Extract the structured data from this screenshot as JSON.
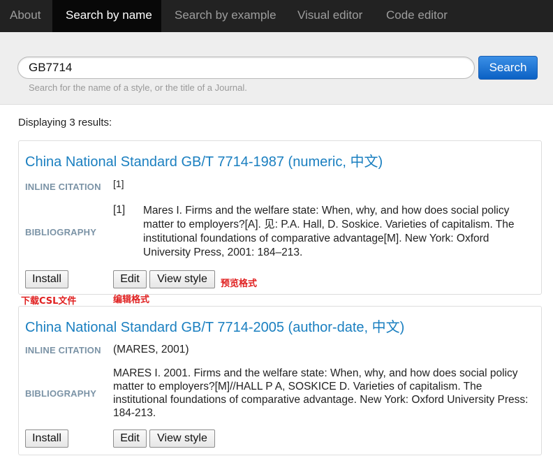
{
  "nav": {
    "tabs": [
      {
        "label": "About"
      },
      {
        "label": "Search by name"
      },
      {
        "label": "Search by example"
      },
      {
        "label": "Visual editor"
      },
      {
        "label": "Code editor"
      }
    ],
    "active_tab": "Search by name"
  },
  "search": {
    "value": "GB7714",
    "button_label": "Search",
    "hint": "Search for the name of a style, or the title of a Journal."
  },
  "results": {
    "count_text": "Displaying 3 results:",
    "items": [
      {
        "title": "China National Standard GB/T 7714-1987 (numeric, 中文)",
        "inline_label": "INLINE CITATION",
        "inline_text": "[1]",
        "bib_label": "BIBLIOGRAPHY",
        "bib_number": "[1]",
        "bib_text": "Mares I. Firms and the welfare state: When, why, and how does social policy matter to employers?[A]. 见: P.A. Hall, D. Soskice. Varieties of capitalism. The institutional foundations of comparative advantage[M]. New York: Oxford University Press, 2001: 184–213.",
        "install_label": "Install",
        "edit_label": "Edit",
        "view_label": "View style"
      },
      {
        "title": "China National Standard GB/T 7714-2005 (author-date, 中文)",
        "inline_label": "INLINE CITATION",
        "inline_text": "(MARES, 2001)",
        "bib_label": "BIBLIOGRAPHY",
        "bib_text": "MARES I. 2001. Firms and the welfare state: When, why, and how does social policy matter to employers?[M]//HALL P A, SOSKICE D. Varieties of capitalism. The institutional foundations of comparative advantage. New York: Oxford University Press: 184-213.",
        "install_label": "Install",
        "edit_label": "Edit",
        "view_label": "View style"
      }
    ]
  },
  "annotations": {
    "preview": "预览格式",
    "download": "下载CSL文件",
    "edit": "编辑格式"
  },
  "colors": {
    "nav_bg": "#222222",
    "search_button": "#0b61c4",
    "title_link": "#1a7fc0",
    "annotation": "#e02020"
  }
}
